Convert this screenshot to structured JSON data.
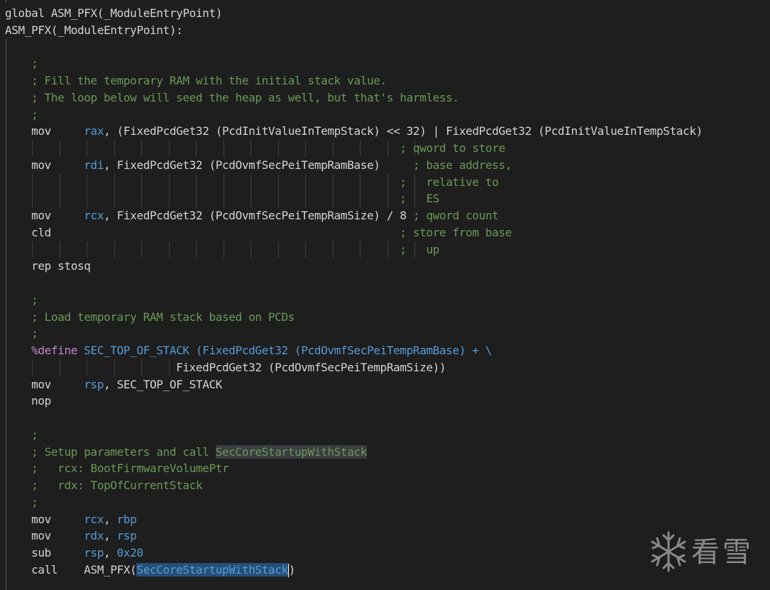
{
  "editor": {
    "lines": [
      {
        "tokens": [
          {
            "t": "global ASM_PFX(_ModuleEntryPoint)",
            "c": "plain"
          }
        ]
      },
      {
        "tokens": [
          {
            "t": "ASM_PFX(_ModuleEntryPoint):",
            "c": "plain"
          }
        ]
      },
      {
        "tokens": []
      },
      {
        "tokens": [
          {
            "t": "    ;",
            "c": "comment"
          }
        ]
      },
      {
        "tokens": [
          {
            "t": "    ; Fill the temporary RAM with the initial stack value.",
            "c": "comment"
          }
        ]
      },
      {
        "tokens": [
          {
            "t": "    ; The loop below will seed the heap as well, but that's harmless.",
            "c": "comment"
          }
        ]
      },
      {
        "tokens": [
          {
            "t": "    ;",
            "c": "comment"
          }
        ]
      },
      {
        "tokens": [
          {
            "t": "    mov     ",
            "c": "plain"
          },
          {
            "t": "rax",
            "c": "reg"
          },
          {
            "t": ", (FixedPcdGet32 (PcdInitValueInTempStack) << 32) | FixedPcdGet32 (PcdInitValueInTempStack)",
            "c": "plain"
          }
        ]
      },
      {
        "tokens": [
          {
            "t": "                                                            ; qword to store",
            "c": "comment"
          }
        ]
      },
      {
        "tokens": [
          {
            "t": "    mov     ",
            "c": "plain"
          },
          {
            "t": "rdi",
            "c": "reg"
          },
          {
            "t": ", FixedPcdGet32 (PcdOvmfSecPeiTempRamBase)     ",
            "c": "plain"
          },
          {
            "t": "; base address,",
            "c": "comment"
          }
        ]
      },
      {
        "tokens": [
          {
            "t": "                                                            ;   relative to",
            "c": "comment"
          }
        ]
      },
      {
        "tokens": [
          {
            "t": "                                                            ;   ES",
            "c": "comment"
          }
        ]
      },
      {
        "tokens": [
          {
            "t": "    mov     ",
            "c": "plain"
          },
          {
            "t": "rcx",
            "c": "reg"
          },
          {
            "t": ", FixedPcdGet32 (PcdOvmfSecPeiTempRamSize) / 8 ",
            "c": "plain"
          },
          {
            "t": "; qword count",
            "c": "comment"
          }
        ]
      },
      {
        "tokens": [
          {
            "t": "    cld                                                     ",
            "c": "plain"
          },
          {
            "t": "; store from base",
            "c": "comment"
          }
        ]
      },
      {
        "tokens": [
          {
            "t": "                                                            ;   up",
            "c": "comment"
          }
        ]
      },
      {
        "tokens": [
          {
            "t": "    rep stosq",
            "c": "plain"
          }
        ]
      },
      {
        "tokens": []
      },
      {
        "tokens": [
          {
            "t": "    ;",
            "c": "comment"
          }
        ]
      },
      {
        "tokens": [
          {
            "t": "    ; Load temporary RAM stack based on PCDs",
            "c": "comment"
          }
        ]
      },
      {
        "tokens": [
          {
            "t": "    ;",
            "c": "comment"
          }
        ]
      },
      {
        "tokens": [
          {
            "t": "    ",
            "c": "plain"
          },
          {
            "t": "%define",
            "c": "macro"
          },
          {
            "t": " SEC_TOP_OF_STACK (FixedPcdGet32 (PcdOvmfSecPeiTempRamBase) + \\",
            "c": "macroname"
          }
        ]
      },
      {
        "tokens": [
          {
            "t": "                          FixedPcdGet32 (PcdOvmfSecPeiTempRamSize))",
            "c": "plain"
          }
        ]
      },
      {
        "tokens": [
          {
            "t": "    mov     ",
            "c": "plain"
          },
          {
            "t": "rsp",
            "c": "reg"
          },
          {
            "t": ", SEC_TOP_OF_STACK",
            "c": "plain"
          }
        ]
      },
      {
        "tokens": [
          {
            "t": "    nop",
            "c": "plain"
          }
        ]
      },
      {
        "tokens": []
      },
      {
        "tokens": [
          {
            "t": "    ;",
            "c": "comment"
          }
        ]
      },
      {
        "tokens": [
          {
            "t": "    ; Setup parameters and call ",
            "c": "comment"
          },
          {
            "t": "SecCoreStartupWithStack",
            "c": "comment-hl"
          }
        ]
      },
      {
        "tokens": [
          {
            "t": "    ;   rcx: BootFirmwareVolumePtr",
            "c": "comment"
          }
        ]
      },
      {
        "tokens": [
          {
            "t": "    ;   rdx: TopOfCurrentStack",
            "c": "comment"
          }
        ]
      },
      {
        "tokens": [
          {
            "t": "    ;",
            "c": "comment"
          }
        ]
      },
      {
        "tokens": [
          {
            "t": "    mov     ",
            "c": "plain"
          },
          {
            "t": "rcx",
            "c": "reg"
          },
          {
            "t": ", ",
            "c": "plain"
          },
          {
            "t": "rbp",
            "c": "reg"
          }
        ]
      },
      {
        "tokens": [
          {
            "t": "    mov     ",
            "c": "plain"
          },
          {
            "t": "rdx",
            "c": "reg"
          },
          {
            "t": ", ",
            "c": "plain"
          },
          {
            "t": "rsp",
            "c": "reg"
          }
        ]
      },
      {
        "tokens": [
          {
            "t": "    sub     ",
            "c": "plain"
          },
          {
            "t": "rsp",
            "c": "reg"
          },
          {
            "t": ", ",
            "c": "plain"
          },
          {
            "t": "0x20",
            "c": "reg"
          }
        ]
      },
      {
        "tokens": [
          {
            "t": "    call    ASM_PFX(",
            "c": "plain"
          },
          {
            "t": "SecCoreStartupWithStack",
            "c": "selected"
          },
          {
            "t": ")",
            "c": "plain"
          }
        ]
      }
    ]
  },
  "watermark": {
    "text": "看雪",
    "logo": "snowflake-icon"
  },
  "colors": {
    "background": "#1e1e1e",
    "text": "#d4d4d4",
    "register": "#569cd6",
    "comment": "#6a9955",
    "directive": "#c586c0",
    "selection": "#264f78"
  }
}
